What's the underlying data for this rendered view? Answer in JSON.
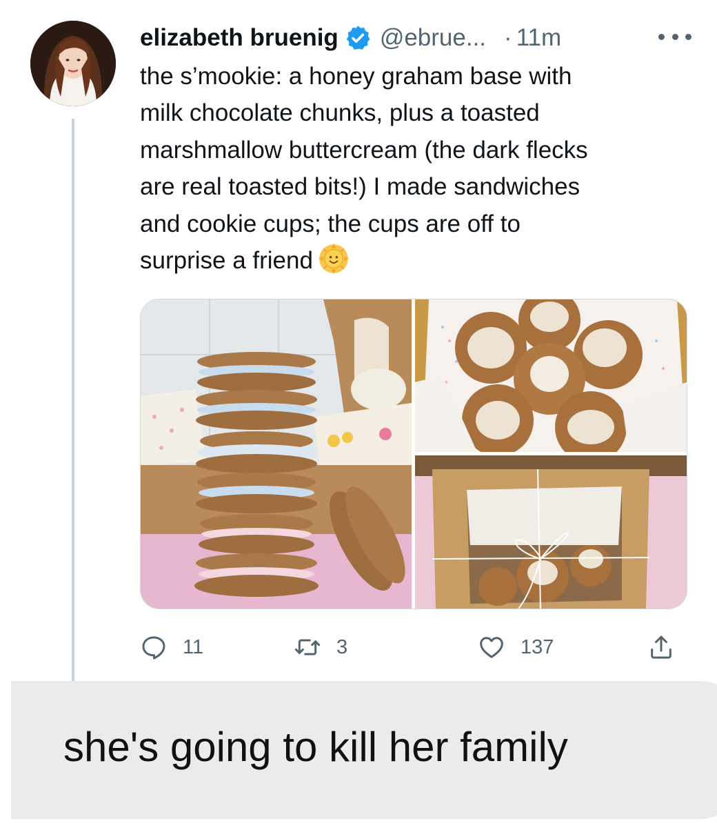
{
  "tweet": {
    "author": {
      "display_name": "elizabeth bruenig",
      "handle": "@ebrue...",
      "verified": true,
      "avatar_icon": "profile-photo"
    },
    "separator": "·",
    "timestamp": "11m",
    "more_icon": "more-horizontal-icon",
    "text_lines": [
      "the s’mookie: a honey graham base with",
      "milk chocolate chunks, plus a toasted",
      "marshmallow buttercream (the dark flecks",
      "are real toasted bits!) I made sandwiches",
      "and cookie cups; the cups are off to",
      "surprise a friend"
    ],
    "emoji": "sun-with-face-emoji",
    "media": [
      {
        "kind": "photo",
        "subject": "stack of sandwich cookies"
      },
      {
        "kind": "photo",
        "subject": "cookie cups in box"
      },
      {
        "kind": "photo",
        "subject": "boxed cookie cups tied with string"
      }
    ],
    "actions": {
      "reply": {
        "icon": "reply-icon",
        "count": "11"
      },
      "retweet": {
        "icon": "retweet-icon",
        "count": "3"
      },
      "like": {
        "icon": "heart-icon",
        "count": "137"
      },
      "share": {
        "icon": "share-icon"
      }
    },
    "colors": {
      "text": "#0f1419",
      "secondary": "#536471",
      "verified": "#1d9bf0",
      "thread_line": "#c9d2d9"
    }
  },
  "reply_message": {
    "text": "she's going to kill her family",
    "bubble_color": "#e9ebed"
  }
}
